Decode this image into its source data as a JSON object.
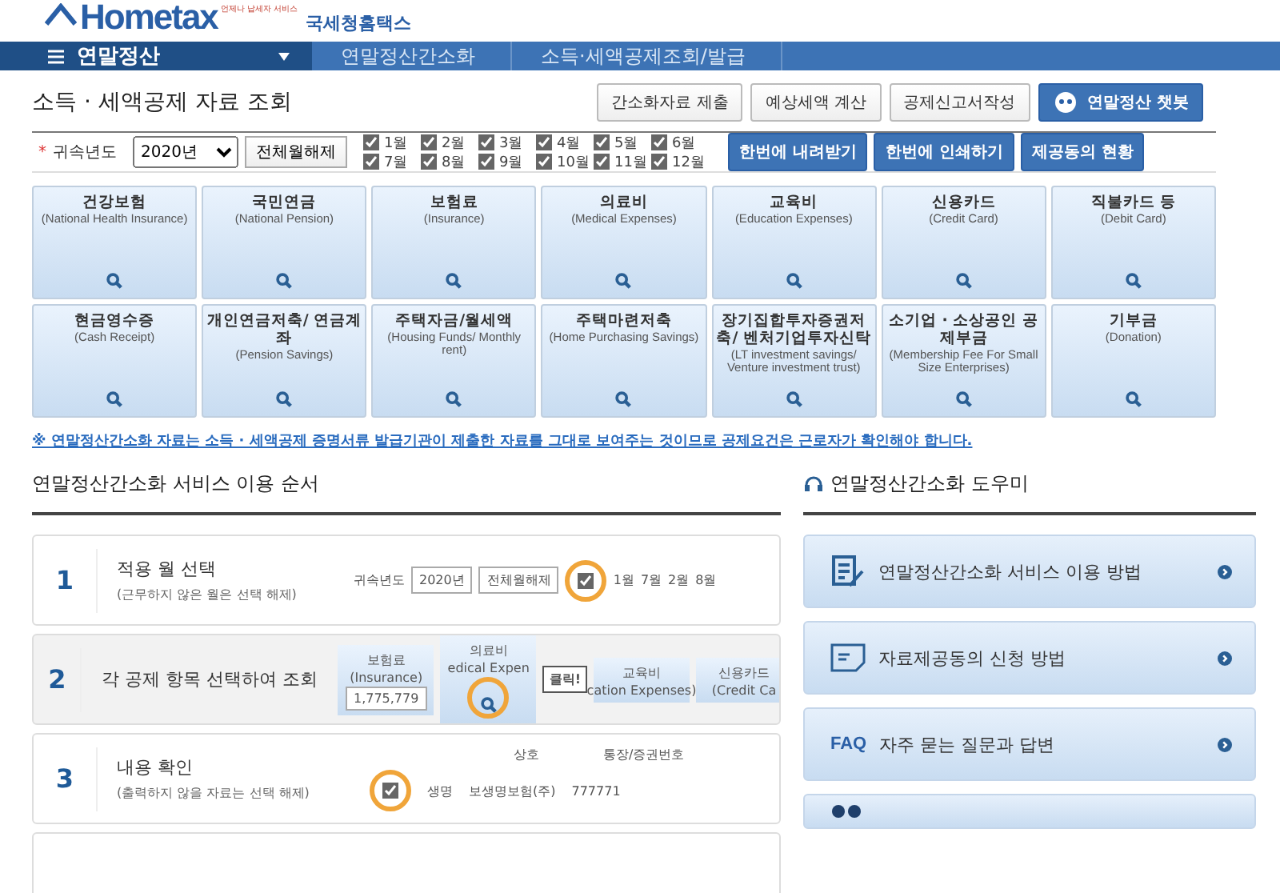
{
  "logo": {
    "brand": "Hometax",
    "tagline": "언제나 납세자 서비스",
    "agency": "국세청홈택스"
  },
  "nav": {
    "menu": "연말정산",
    "crumbs": [
      "연말정산간소화",
      "소득·세액공제조회/발급"
    ]
  },
  "page_title": "소득 · 세액공제 자료 조회",
  "top_buttons": [
    {
      "label": "간소화자료 제출",
      "kind": "plain"
    },
    {
      "label": "예상세액 계산",
      "kind": "plain"
    },
    {
      "label": "공제신고서작성",
      "kind": "plain"
    },
    {
      "label": "연말정산 챗봇",
      "kind": "bot"
    }
  ],
  "filter": {
    "required_mark": "*",
    "label": "귀속년도",
    "year": "2020년",
    "clear_button": "전체월해제",
    "months": [
      {
        "label": "1월",
        "checked": true
      },
      {
        "label": "2월",
        "checked": true
      },
      {
        "label": "3월",
        "checked": true
      },
      {
        "label": "4월",
        "checked": true
      },
      {
        "label": "5월",
        "checked": true
      },
      {
        "label": "6월",
        "checked": true
      },
      {
        "label": "7월",
        "checked": true
      },
      {
        "label": "8월",
        "checked": true
      },
      {
        "label": "9월",
        "checked": true
      },
      {
        "label": "10월",
        "checked": true
      },
      {
        "label": "11월",
        "checked": true
      },
      {
        "label": "12월",
        "checked": true
      }
    ],
    "actions": [
      "한번에 내려받기",
      "한번에 인쇄하기",
      "제공동의 현황"
    ]
  },
  "categories": [
    {
      "title": "건강보험",
      "subtitle": "(National Health Insurance)"
    },
    {
      "title": "국민연금",
      "subtitle": "(National Pension)"
    },
    {
      "title": "보험료",
      "subtitle": "(Insurance)"
    },
    {
      "title": "의료비",
      "subtitle": "(Medical Expenses)"
    },
    {
      "title": "교육비",
      "subtitle": "(Education Expenses)"
    },
    {
      "title": "신용카드",
      "subtitle": "(Credit Card)"
    },
    {
      "title": "직불카드 등",
      "subtitle": "(Debit Card)"
    },
    {
      "title": "현금영수증",
      "subtitle": "(Cash Receipt)"
    },
    {
      "title": "개인연금저축/ 연금계좌",
      "subtitle": "(Pension Savings)"
    },
    {
      "title": "주택자금/월세액",
      "subtitle": "(Housing Funds/ Monthly rent)"
    },
    {
      "title": "주택마련저축",
      "subtitle": "(Home Purchasing Savings)"
    },
    {
      "title": "장기집합투자증권저축/ 벤처기업투자신탁",
      "subtitle": "(LT investment savings/ Venture investment trust)"
    },
    {
      "title": "소기업 · 소상공인 공제부금",
      "subtitle": "(Membership Fee For Small Size Enterprises)"
    },
    {
      "title": "기부금",
      "subtitle": "(Donation)"
    }
  ],
  "notice": "※ 연말정산간소화 자료는 소득 · 세액공제 증명서류 발급기관이 제출한 자료를 그대로 보여주는 것이므로 공제요건은 근로자가 확인해야 합니다.",
  "steps_title": "연말정산간소화 서비스 이용 순서",
  "steps": [
    {
      "number": "1",
      "title": "적용 월 선택",
      "hint": "(근무하지 않은 월은 선택 해제)",
      "demo": {
        "kind": "months",
        "checked": true,
        "texts": [
          "귀속년도",
          "2020년",
          "전체월해제",
          "1월",
          "7월",
          "2월",
          "8월"
        ]
      }
    },
    {
      "number": "2",
      "title": "각 공제 항목 선택하여 조회",
      "demo": {
        "kind": "cards",
        "texts": [
          "보험료",
          "(Insurance)",
          "1,775,779",
          "의료비",
          "edical Expen",
          "클릭!",
          "교육비",
          "cation Expenses)",
          "신용카드",
          "(Credit Ca"
        ]
      }
    },
    {
      "number": "3",
      "title": "내용 확인",
      "hint": "(출력하지 않을 자료는 선택 해제)",
      "demo": {
        "kind": "table",
        "checked": true,
        "texts": [
          "상호",
          "통장/증권번호",
          "생명",
          "보생명보험(주)",
          "777771"
        ]
      }
    }
  ],
  "helper_title": "연말정산간소화 도우미",
  "helper_items": [
    {
      "label": "연말정산간소화 서비스 이용 방법",
      "kind": "guide"
    },
    {
      "label": "자료제공동의 신청 방법",
      "kind": "doc"
    },
    {
      "label": "자주 묻는 질문과 답변",
      "kind": "faq",
      "tag": "FAQ"
    },
    {
      "kind": "chat"
    }
  ]
}
